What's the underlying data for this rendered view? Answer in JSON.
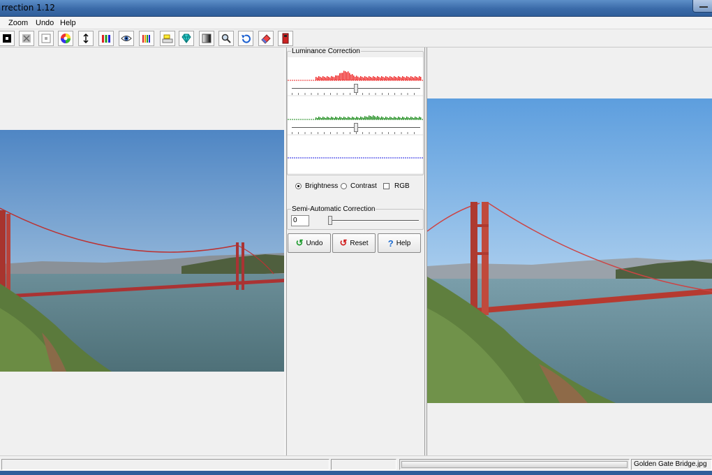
{
  "window": {
    "title": "rrection 1.12"
  },
  "menu": {
    "zoom": "Zoom",
    "undo": "Undo",
    "help": "Help"
  },
  "toolbar": {
    "icons": [
      "black-square-icon",
      "crossed-square-icon",
      "white-square-icon",
      "color-wheel-icon",
      "vertical-arrows-icon",
      "color-bars-icon",
      "eye-icon",
      "colored-pencils-icon",
      "paint-bucket-icon",
      "diamond-icon",
      "gradient-icon",
      "magnifier-icon",
      "undo-arrow-icon",
      "eraser-icon",
      "exit-icon"
    ]
  },
  "correction": {
    "luminance_title": "Luminance Correction",
    "channels": [
      {
        "name": "red",
        "color": "#ee2020",
        "slider_value": 0.5
      },
      {
        "name": "green",
        "color": "#1a8a1a",
        "slider_value": 0.5
      },
      {
        "name": "blue",
        "color": "#1a1ae0"
      }
    ],
    "mode_brightness": "Brightness",
    "mode_contrast": "Contrast",
    "mode_rgb": "RGB",
    "selected_mode": "Brightness",
    "semi_title": "Semi-Automatic Correction",
    "semi_value": "0",
    "semi_slider_value": 0.0
  },
  "buttons": {
    "undo": "Undo",
    "reset": "Reset",
    "help": "Help"
  },
  "status": {
    "filename": "Golden Gate Bridge.jpg"
  }
}
